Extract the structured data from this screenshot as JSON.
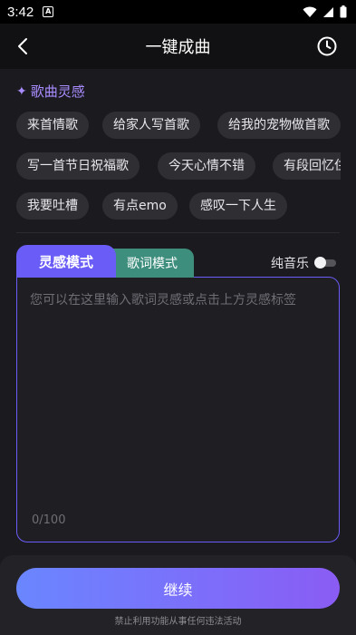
{
  "status_bar": {
    "time": "3:42",
    "notification_icon": "A"
  },
  "nav": {
    "title": "一键成曲",
    "back_icon": "chevron-left-icon",
    "history_icon": "clock-icon"
  },
  "inspiration": {
    "title": "歌曲灵感",
    "icon": "✦",
    "tags_row1": [
      "来首情歌",
      "给家人写首歌",
      "给我的宠物做首歌"
    ],
    "tags_row2": [
      "写一首节日祝福歌",
      "今天心情不错",
      "有段回忆住"
    ],
    "tags_row3": [
      "我要吐槽",
      "有点emo",
      "感叹一下人生"
    ]
  },
  "tabs": {
    "active": "灵感模式",
    "inactive": "歌词模式"
  },
  "pure_music": {
    "label": "纯音乐",
    "enabled": false
  },
  "input": {
    "placeholder": "您可以在这里输入歌词灵感或点击上方灵感标签",
    "value": "",
    "count": "0/100"
  },
  "footer": {
    "button_label": "继续",
    "disclaimer": "禁止利用功能从事任何违法活动"
  },
  "colors": {
    "accent": "#6a5cf6",
    "tag_bg": "#2f2f33",
    "inactive_tab": "#3e8e7e",
    "section_title": "#a98cff"
  }
}
